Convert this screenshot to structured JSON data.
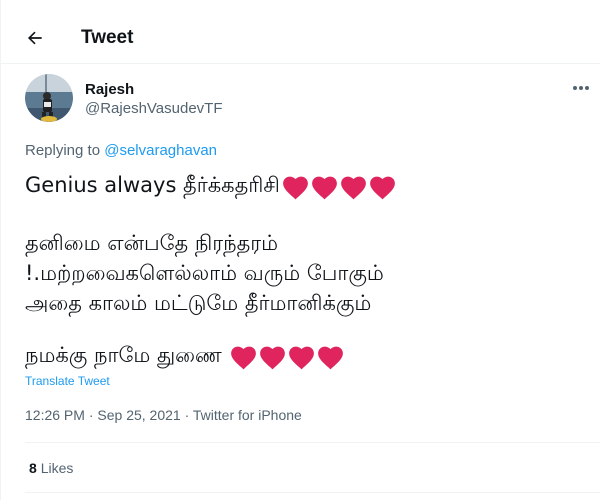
{
  "header": {
    "title": "Tweet",
    "back_icon": "arrow-left-icon"
  },
  "author": {
    "name": "Rajesh",
    "handle": "@RajeshVasudevTF",
    "avatar": "profile-photo"
  },
  "more_icon": "more-horizontal-icon",
  "reply": {
    "prefix": "Replying to ",
    "mention": "@selvaraghavan"
  },
  "tweet": {
    "line1": "Genius always தீர்க்கதரிசி",
    "line1_emoji": "❤❤❤❤",
    "line2": "தனிமை என்பதே நிரந்தரம்",
    "line3": "!.மற்றவைகளெல்லாம் வரும் போகும்",
    "line4": "அதை காலம் மட்டுமே தீர்மானிக்கும்",
    "line5": "நமக்கு நாமே துணை",
    "line5_emoji": "❤❤❤❤"
  },
  "translate_label": "Translate Tweet",
  "meta": {
    "time": "12:26 PM",
    "sep1": " · ",
    "date": "Sep 25, 2021",
    "sep2": " · ",
    "source": "Twitter for iPhone"
  },
  "stats": {
    "likes_count": "8",
    "likes_label": "Likes"
  },
  "colors": {
    "accent": "#1d9bf0",
    "heart": "#e0245e",
    "secondary_text": "#536471",
    "border": "#eff3f4"
  }
}
